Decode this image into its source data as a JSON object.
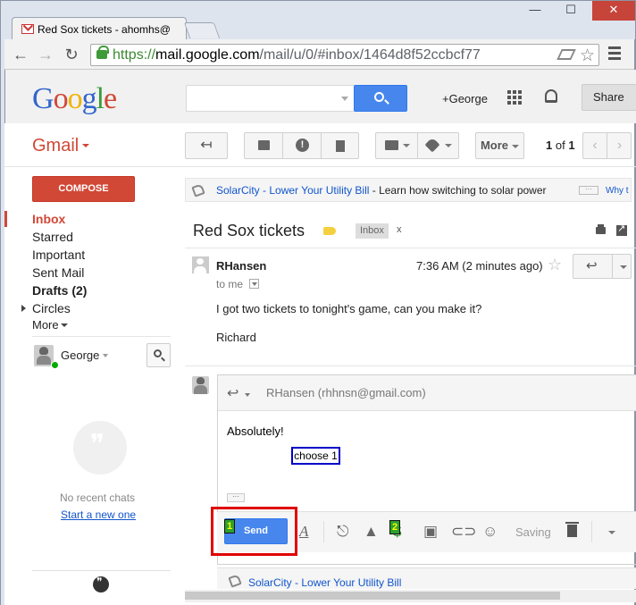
{
  "browser": {
    "tab_title": "Red Sox tickets - ahomhs@",
    "url_scheme": "https://",
    "url_host": "mail.google.com",
    "url_path": "/mail/u/0/#inbox/1464d8f52ccbcf77",
    "window_buttons": {
      "minimize": "—",
      "maximize": "☐",
      "close": "✕"
    },
    "nav": {
      "back": "←",
      "forward": "→",
      "reload": "↻"
    },
    "icons": {
      "favicon": "gmail-icon",
      "lock": "lock-icon",
      "star": "star-icon",
      "menu": "hamburger-icon"
    }
  },
  "header": {
    "logo_letters": [
      {
        "ch": "G",
        "color": "#3366cc"
      },
      {
        "ch": "o",
        "color": "#d14836"
      },
      {
        "ch": "o",
        "color": "#f0b400"
      },
      {
        "ch": "g",
        "color": "#3366cc"
      },
      {
        "ch": "l",
        "color": "#3a9a3a"
      },
      {
        "ch": "e",
        "color": "#d14836"
      }
    ],
    "search_value": "",
    "user_link": "+George",
    "share_label": "Share"
  },
  "gmail_bar": {
    "app_label": "Gmail",
    "more_label": "More",
    "page_count_bold": "1",
    "page_count_mid": " of ",
    "page_count_total": "1"
  },
  "sidebar": {
    "compose_label": "COMPOSE",
    "items": [
      {
        "label": "Inbox"
      },
      {
        "label": "Starred"
      },
      {
        "label": "Important"
      },
      {
        "label": "Sent Mail"
      },
      {
        "label": "Drafts (2)"
      },
      {
        "label": "Circles"
      },
      {
        "label": "More"
      }
    ],
    "chat_user": "George",
    "no_chats": "No recent chats",
    "start_link": "Start a new one"
  },
  "ad": {
    "advertiser": "SolarCity",
    "separator": " - ",
    "headline": "Lower Your Utility Bill",
    "body": " - Learn how switching to solar power",
    "dots": "···",
    "why": "Why t"
  },
  "message": {
    "subject": "Red Sox tickets",
    "label_chip": "Inbox",
    "label_chip_close": "x",
    "sender": "RHansen",
    "recipient": "to me",
    "time": "7:36 AM (2 minutes ago)",
    "body_line_1": "I got two tickets to tonight's game, can you make it?",
    "body_line_2": "Richard"
  },
  "reply": {
    "to": "RHansen (rhhnsn@gmail.com)",
    "text": "Absolutely!",
    "choose_label": "choose 1",
    "ellipsis": "···",
    "send_label": "Send",
    "saving_label": "Saving",
    "hint_1": "1",
    "hint_2": "2"
  },
  "bottom_ad": {
    "text": "SolarCity - Lower Your Utility Bill"
  },
  "colors": {
    "gmail_red": "#d14836",
    "link_blue": "#1155cc",
    "send_blue": "#4787ed",
    "highlight_red": "#e00000",
    "hint_green": "#2da12d"
  }
}
